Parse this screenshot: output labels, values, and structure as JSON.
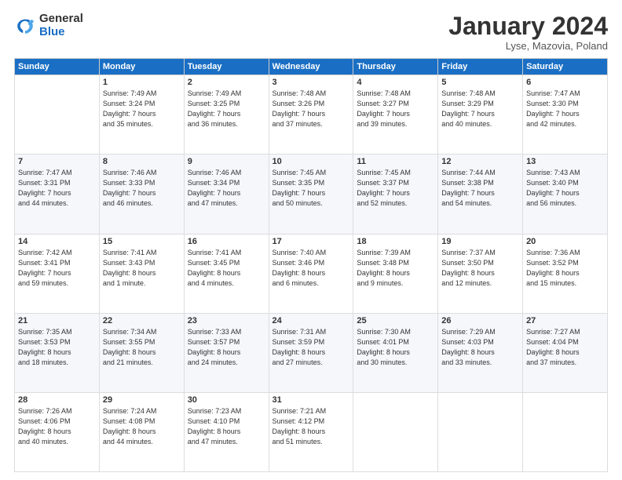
{
  "header": {
    "logo_general": "General",
    "logo_blue": "Blue",
    "month_title": "January 2024",
    "location": "Lyse, Mazovia, Poland"
  },
  "weekdays": [
    "Sunday",
    "Monday",
    "Tuesday",
    "Wednesday",
    "Thursday",
    "Friday",
    "Saturday"
  ],
  "weeks": [
    [
      {
        "day": "",
        "info": ""
      },
      {
        "day": "1",
        "info": "Sunrise: 7:49 AM\nSunset: 3:24 PM\nDaylight: 7 hours\nand 35 minutes."
      },
      {
        "day": "2",
        "info": "Sunrise: 7:49 AM\nSunset: 3:25 PM\nDaylight: 7 hours\nand 36 minutes."
      },
      {
        "day": "3",
        "info": "Sunrise: 7:48 AM\nSunset: 3:26 PM\nDaylight: 7 hours\nand 37 minutes."
      },
      {
        "day": "4",
        "info": "Sunrise: 7:48 AM\nSunset: 3:27 PM\nDaylight: 7 hours\nand 39 minutes."
      },
      {
        "day": "5",
        "info": "Sunrise: 7:48 AM\nSunset: 3:29 PM\nDaylight: 7 hours\nand 40 minutes."
      },
      {
        "day": "6",
        "info": "Sunrise: 7:47 AM\nSunset: 3:30 PM\nDaylight: 7 hours\nand 42 minutes."
      }
    ],
    [
      {
        "day": "7",
        "info": "Sunrise: 7:47 AM\nSunset: 3:31 PM\nDaylight: 7 hours\nand 44 minutes."
      },
      {
        "day": "8",
        "info": "Sunrise: 7:46 AM\nSunset: 3:33 PM\nDaylight: 7 hours\nand 46 minutes."
      },
      {
        "day": "9",
        "info": "Sunrise: 7:46 AM\nSunset: 3:34 PM\nDaylight: 7 hours\nand 47 minutes."
      },
      {
        "day": "10",
        "info": "Sunrise: 7:45 AM\nSunset: 3:35 PM\nDaylight: 7 hours\nand 50 minutes."
      },
      {
        "day": "11",
        "info": "Sunrise: 7:45 AM\nSunset: 3:37 PM\nDaylight: 7 hours\nand 52 minutes."
      },
      {
        "day": "12",
        "info": "Sunrise: 7:44 AM\nSunset: 3:38 PM\nDaylight: 7 hours\nand 54 minutes."
      },
      {
        "day": "13",
        "info": "Sunrise: 7:43 AM\nSunset: 3:40 PM\nDaylight: 7 hours\nand 56 minutes."
      }
    ],
    [
      {
        "day": "14",
        "info": "Sunrise: 7:42 AM\nSunset: 3:41 PM\nDaylight: 7 hours\nand 59 minutes."
      },
      {
        "day": "15",
        "info": "Sunrise: 7:41 AM\nSunset: 3:43 PM\nDaylight: 8 hours\nand 1 minute."
      },
      {
        "day": "16",
        "info": "Sunrise: 7:41 AM\nSunset: 3:45 PM\nDaylight: 8 hours\nand 4 minutes."
      },
      {
        "day": "17",
        "info": "Sunrise: 7:40 AM\nSunset: 3:46 PM\nDaylight: 8 hours\nand 6 minutes."
      },
      {
        "day": "18",
        "info": "Sunrise: 7:39 AM\nSunset: 3:48 PM\nDaylight: 8 hours\nand 9 minutes."
      },
      {
        "day": "19",
        "info": "Sunrise: 7:37 AM\nSunset: 3:50 PM\nDaylight: 8 hours\nand 12 minutes."
      },
      {
        "day": "20",
        "info": "Sunrise: 7:36 AM\nSunset: 3:52 PM\nDaylight: 8 hours\nand 15 minutes."
      }
    ],
    [
      {
        "day": "21",
        "info": "Sunrise: 7:35 AM\nSunset: 3:53 PM\nDaylight: 8 hours\nand 18 minutes."
      },
      {
        "day": "22",
        "info": "Sunrise: 7:34 AM\nSunset: 3:55 PM\nDaylight: 8 hours\nand 21 minutes."
      },
      {
        "day": "23",
        "info": "Sunrise: 7:33 AM\nSunset: 3:57 PM\nDaylight: 8 hours\nand 24 minutes."
      },
      {
        "day": "24",
        "info": "Sunrise: 7:31 AM\nSunset: 3:59 PM\nDaylight: 8 hours\nand 27 minutes."
      },
      {
        "day": "25",
        "info": "Sunrise: 7:30 AM\nSunset: 4:01 PM\nDaylight: 8 hours\nand 30 minutes."
      },
      {
        "day": "26",
        "info": "Sunrise: 7:29 AM\nSunset: 4:03 PM\nDaylight: 8 hours\nand 33 minutes."
      },
      {
        "day": "27",
        "info": "Sunrise: 7:27 AM\nSunset: 4:04 PM\nDaylight: 8 hours\nand 37 minutes."
      }
    ],
    [
      {
        "day": "28",
        "info": "Sunrise: 7:26 AM\nSunset: 4:06 PM\nDaylight: 8 hours\nand 40 minutes."
      },
      {
        "day": "29",
        "info": "Sunrise: 7:24 AM\nSunset: 4:08 PM\nDaylight: 8 hours\nand 44 minutes."
      },
      {
        "day": "30",
        "info": "Sunrise: 7:23 AM\nSunset: 4:10 PM\nDaylight: 8 hours\nand 47 minutes."
      },
      {
        "day": "31",
        "info": "Sunrise: 7:21 AM\nSunset: 4:12 PM\nDaylight: 8 hours\nand 51 minutes."
      },
      {
        "day": "",
        "info": ""
      },
      {
        "day": "",
        "info": ""
      },
      {
        "day": "",
        "info": ""
      }
    ]
  ]
}
